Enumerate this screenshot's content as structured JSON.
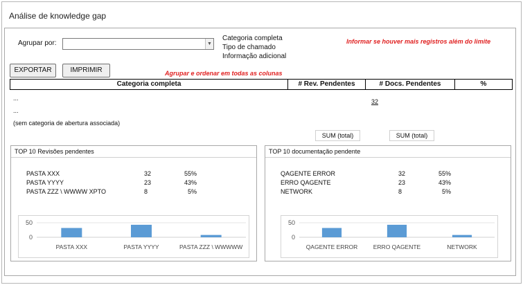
{
  "window": {
    "title": "Análise de knowledge gap"
  },
  "filter": {
    "group_label": "Agrupar por:",
    "group_value": "",
    "options": [
      "Categoria completa",
      "Tipo de chamado",
      "Informação adicional"
    ]
  },
  "notes": {
    "limit": "Informar se houver mais registros além do limite",
    "order": "Agrupar e ordenar em todas as colunas"
  },
  "buttons": {
    "export": "EXPORTAR",
    "print": "IMPRIMIR"
  },
  "grid": {
    "columns": [
      "Categoria completa",
      "# Rev. Pendentes",
      "# Docs. Pendentes",
      "%"
    ],
    "rows": [
      "...",
      "...",
      "(sem categoria de abertura associada)"
    ],
    "count_link": "32",
    "sum_rev": "SUM (total)",
    "sum_docs": "SUM (total)"
  },
  "top_reviews": {
    "title": "TOP 10 Revisões pendentes",
    "items": [
      {
        "name": "PASTA XXX",
        "value": "32",
        "pct": "55%"
      },
      {
        "name": "PASTA YYYY",
        "value": "23",
        "pct": "43%"
      },
      {
        "name": "PASTA ZZZ \\ WWWW XPTO",
        "value": "8",
        "pct": "5%"
      }
    ]
  },
  "top_docs": {
    "title": "TOP 10 documentação pendente",
    "items": [
      {
        "name": "QAGENTE ERROR",
        "value": "32",
        "pct": "55%"
      },
      {
        "name": "ERRO QAGENTE",
        "value": "23",
        "pct": "43%"
      },
      {
        "name": "NETWORK",
        "value": "8",
        "pct": "5%"
      }
    ]
  },
  "chart_data": [
    {
      "type": "bar",
      "categories": [
        "PASTA XXX",
        "PASTA YYYY",
        "PASTA ZZZ \\ WWWWW"
      ],
      "values": [
        32,
        43,
        8
      ],
      "yticks": [
        "50",
        "0"
      ],
      "ylim": [
        0,
        50
      ],
      "color": "#5b9bd5"
    },
    {
      "type": "bar",
      "categories": [
        "QAGENTE ERROR",
        "ERRO QAGENTE",
        "NETWORK"
      ],
      "values": [
        32,
        43,
        8
      ],
      "yticks": [
        "50",
        "0"
      ],
      "ylim": [
        0,
        50
      ],
      "color": "#5b9bd5"
    }
  ]
}
